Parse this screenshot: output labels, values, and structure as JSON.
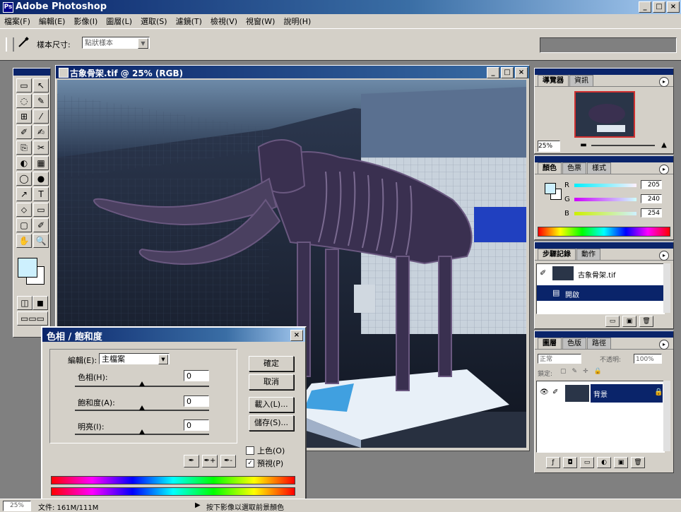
{
  "app": {
    "title": "Adobe Photoshop",
    "icon_letter": "Ps",
    "window_buttons": [
      "_",
      "□",
      "×"
    ]
  },
  "menu": {
    "items": [
      "檔案(F)",
      "編輯(E)",
      "影像(I)",
      "圖層(L)",
      "選取(S)",
      "濾鏡(T)",
      "檢視(V)",
      "視窗(W)",
      "說明(H)"
    ]
  },
  "options_bar": {
    "tool_icon": "eyedropper-icon",
    "sample_label": "樣本尺寸:",
    "sample_value": "點狀樣本"
  },
  "document": {
    "title": "古象骨架.tif @ 25% (RGB)",
    "buttons": [
      "_",
      "□",
      "×"
    ]
  },
  "toolbox": {
    "tools": [
      "▭",
      "↖",
      "◌",
      "✎",
      "⊞",
      "⁄",
      "✐",
      "✍",
      "⎘",
      "✂",
      "◐",
      "▦",
      "◯",
      "●",
      "↗",
      "T",
      "⬦",
      "▭",
      "▢",
      "✐",
      "✋",
      "🔍"
    ]
  },
  "navigator": {
    "tabs": [
      "導覽器",
      "資訊"
    ],
    "zoom": "25%"
  },
  "color_panel": {
    "tabs": [
      "顏色",
      "色票",
      "樣式"
    ],
    "channels": [
      {
        "label": "R",
        "value": "205"
      },
      {
        "label": "G",
        "value": "240"
      },
      {
        "label": "B",
        "value": "254"
      }
    ]
  },
  "history_panel": {
    "tabs": [
      "步驟記錄",
      "動作"
    ],
    "items": [
      {
        "label": "古象骨架.tif"
      },
      {
        "label": "開啟"
      }
    ]
  },
  "layers_panel": {
    "tabs": [
      "圖層",
      "色版",
      "路徑"
    ],
    "mode": "正常",
    "opacity_label": "不透明:",
    "opacity": "100%",
    "lock_label": "鎖定:",
    "layer_name": "背景"
  },
  "hue_dialog": {
    "title": "色相 / 飽和度",
    "edit_label": "編輯(E):",
    "edit_value": "主檔案",
    "hue_label": "色相(H):",
    "hue_value": "0",
    "saturation_label": "飽和度(A):",
    "saturation_value": "0",
    "lightness_label": "明亮(I):",
    "lightness_value": "0",
    "ok": "確定",
    "cancel": "取消",
    "load": "載入(L)...",
    "save": "儲存(S)...",
    "colorize": "上色(O)",
    "preview": "預視(P)",
    "preview_checked": "✓",
    "colorize_checked": ""
  },
  "status": {
    "zoom": "25%",
    "doc": "文件: 161M/111M",
    "hint": "按下影像以選取前景顏色"
  },
  "colors": {
    "title_dark": "#0a246a",
    "title_light": "#3a6ea5",
    "chrome": "#d4d0c8",
    "fg_swatch": "#cdf0fe",
    "selection": "#0a246a"
  }
}
